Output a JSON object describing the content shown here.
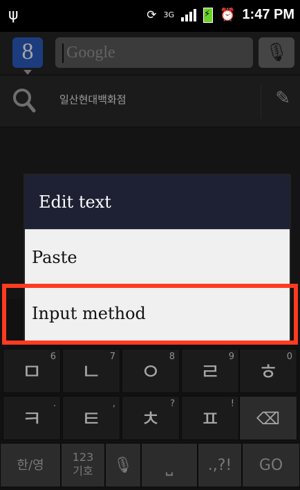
{
  "status": {
    "time": "1:47 PM",
    "network": "3G"
  },
  "search": {
    "placeholder": "Google",
    "g_logo": "8"
  },
  "suggestion": {
    "text": "일산현대백화점"
  },
  "dialog": {
    "title": "Edit text",
    "items": [
      "Paste",
      "Input method"
    ]
  },
  "keyboard": {
    "row1": [
      {
        "label": "ㅁ",
        "hint": "6"
      },
      {
        "label": "ㄴ",
        "hint": "7"
      },
      {
        "label": "ㅇ",
        "hint": "8"
      },
      {
        "label": "ㄹ",
        "hint": "9"
      },
      {
        "label": "ㅎ",
        "hint": "0"
      }
    ],
    "row2": [
      {
        "label": "ㅋ",
        "hint": "."
      },
      {
        "label": "ㅌ",
        "hint": ","
      },
      {
        "label": "ㅊ",
        "hint": "?"
      },
      {
        "label": "ㅍ",
        "hint": "!"
      },
      {
        "label": "⌫",
        "hint": ""
      }
    ],
    "row3": {
      "lang": "한/영",
      "num1": "123",
      "num2": "기호",
      "punct": ".,?!",
      "go": "GO"
    }
  },
  "icons": [
    "usb-icon",
    "sync-icon",
    "signal-bars-icon",
    "battery-icon",
    "alarm-icon",
    "google-logo-icon",
    "mic-icon",
    "search-icon",
    "pencil-icon",
    "space-icon"
  ]
}
